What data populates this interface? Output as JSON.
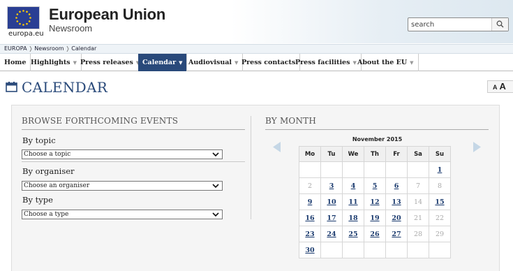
{
  "header": {
    "logo_text": "europa.eu",
    "title": "European Union",
    "subtitle": "Newsroom",
    "search_value": "search"
  },
  "breadcrumb": [
    "EUROPA",
    "Newsroom",
    "Calendar"
  ],
  "nav": {
    "items": [
      {
        "label": "Home",
        "dropdown": false
      },
      {
        "label": "Highlights",
        "dropdown": true
      },
      {
        "label": "Press releases",
        "dropdown": true
      },
      {
        "label": "Calendar",
        "dropdown": true,
        "active": true
      },
      {
        "label": "Audiovisual",
        "dropdown": true
      },
      {
        "label": "Press contacts",
        "dropdown": false
      },
      {
        "label": "Press facilities",
        "dropdown": true
      },
      {
        "label": "About the EU",
        "dropdown": true
      }
    ]
  },
  "page": {
    "title": "CALENDAR",
    "font_small": "A",
    "font_large": "A"
  },
  "browse": {
    "title": "BROWSE FORTHCOMING EVENTS",
    "topic_label": "By topic",
    "topic_value": "Choose a topic",
    "organiser_label": "By organiser",
    "organiser_value": "Choose an organiser",
    "type_label": "By type",
    "type_value": "Choose a type"
  },
  "by_month": {
    "title": "BY MONTH",
    "month": "November 2015",
    "weekdays": [
      "Mo",
      "Tu",
      "We",
      "Th",
      "Fr",
      "Sa",
      "Su"
    ],
    "weeks": [
      [
        null,
        null,
        null,
        null,
        null,
        null,
        {
          "d": "1",
          "ev": true
        }
      ],
      [
        {
          "d": "2",
          "ev": false
        },
        {
          "d": "3",
          "ev": true
        },
        {
          "d": "4",
          "ev": true
        },
        {
          "d": "5",
          "ev": true
        },
        {
          "d": "6",
          "ev": true
        },
        {
          "d": "7",
          "ev": false
        },
        {
          "d": "8",
          "ev": false
        }
      ],
      [
        {
          "d": "9",
          "ev": true
        },
        {
          "d": "10",
          "ev": true
        },
        {
          "d": "11",
          "ev": true
        },
        {
          "d": "12",
          "ev": true
        },
        {
          "d": "13",
          "ev": true
        },
        {
          "d": "14",
          "ev": false
        },
        {
          "d": "15",
          "ev": true
        }
      ],
      [
        {
          "d": "16",
          "ev": true
        },
        {
          "d": "17",
          "ev": true
        },
        {
          "d": "18",
          "ev": true
        },
        {
          "d": "19",
          "ev": true
        },
        {
          "d": "20",
          "ev": true
        },
        {
          "d": "21",
          "ev": false
        },
        {
          "d": "22",
          "ev": false
        }
      ],
      [
        {
          "d": "23",
          "ev": true
        },
        {
          "d": "24",
          "ev": true
        },
        {
          "d": "25",
          "ev": true
        },
        {
          "d": "26",
          "ev": true
        },
        {
          "d": "27",
          "ev": true
        },
        {
          "d": "28",
          "ev": false
        },
        {
          "d": "29",
          "ev": false
        }
      ],
      [
        {
          "d": "30",
          "ev": true
        },
        null,
        null,
        null,
        null,
        null,
        null
      ]
    ]
  },
  "colors": {
    "nav_active": "#29497a",
    "title_blue": "#2a4a7a",
    "event_link": "#1a3a6e",
    "flag_blue": "#2a3f93",
    "flag_star": "#ffcc00"
  },
  "icons": [
    "eu-flag-icon",
    "search-icon",
    "calendar-icon",
    "chevron-down-icon",
    "arrow-left-icon",
    "arrow-right-icon"
  ]
}
